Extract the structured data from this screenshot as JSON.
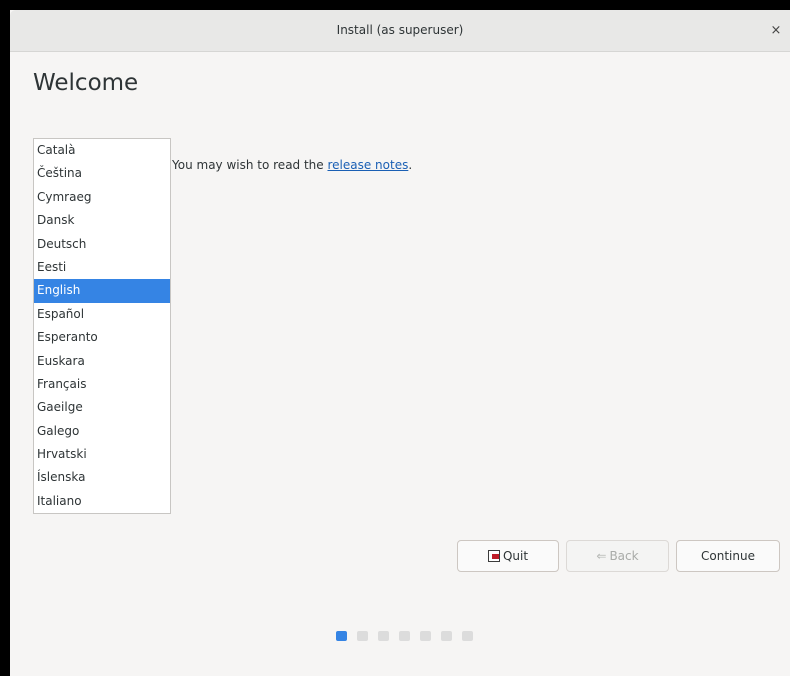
{
  "window": {
    "title": "Install (as superuser)",
    "close_glyph": "×"
  },
  "page": {
    "heading": "Welcome"
  },
  "languages": [
    "Català",
    "Čeština",
    "Cymraeg",
    "Dansk",
    "Deutsch",
    "Eesti",
    "English",
    "Español",
    "Esperanto",
    "Euskara",
    "Français",
    "Gaeilge",
    "Galego",
    "Hrvatski",
    "Íslenska",
    "Italiano"
  ],
  "selected_language": "English",
  "release_notes": {
    "prefix": "You may wish to read the ",
    "link": "release notes",
    "suffix": "."
  },
  "buttons": {
    "quit": "Quit",
    "back": "Back",
    "continue": "Continue"
  },
  "progress": {
    "total_steps": 7,
    "current_step": 1
  },
  "colors": {
    "accent": "#3584e4",
    "link": "#1a5fb4"
  }
}
